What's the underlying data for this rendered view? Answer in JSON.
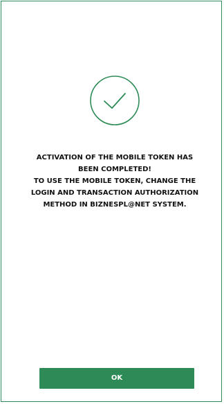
{
  "success": {
    "icon": "check-circle-icon",
    "lines": [
      "ACTIVATION OF THE MOBILE TOKEN HAS",
      "BEEN COMPLETED!",
      "TO USE THE MOBILE TOKEN, CHANGE THE",
      "LOGIN AND TRANSACTION AUTHORIZATION",
      "METHOD IN BIZNESPL@NET SYSTEM."
    ]
  },
  "actions": {
    "ok_label": "OK"
  },
  "colors": {
    "accent": "#2e8b57",
    "text": "#111111",
    "background": "#ffffff"
  }
}
